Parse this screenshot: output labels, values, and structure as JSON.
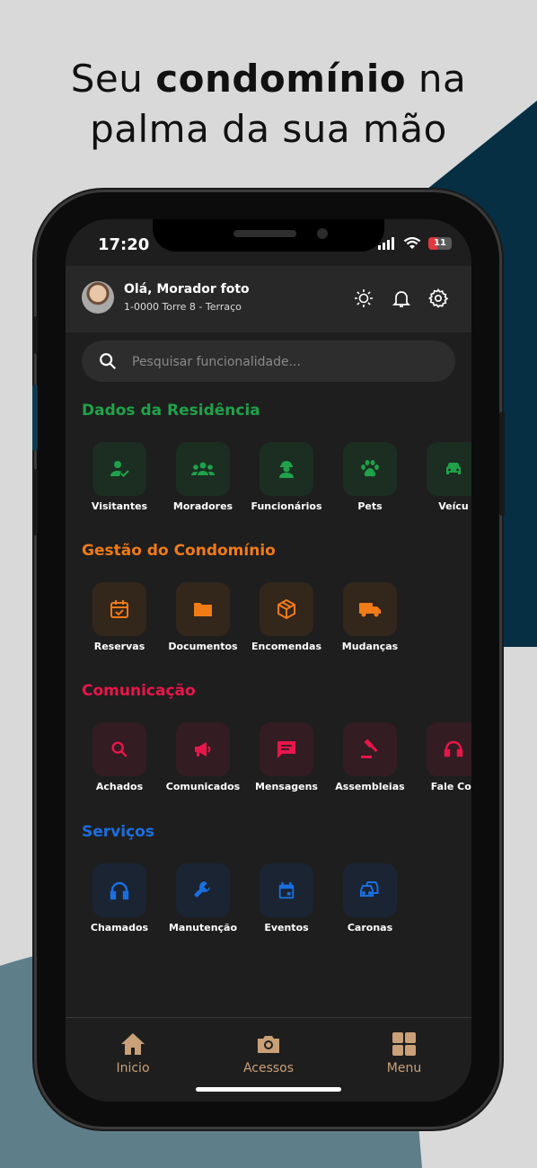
{
  "headline": {
    "part1": "Seu ",
    "bold": "condomínio",
    "part2": " na",
    "line2": "palma da sua mão"
  },
  "status_bar": {
    "time": "17:20",
    "battery": "11"
  },
  "header": {
    "greeting": "Olá, Morador foto",
    "address": "1-0000 Torre 8 - Terraço",
    "icons": [
      "sun-icon",
      "bell-icon",
      "gear-icon"
    ]
  },
  "search": {
    "placeholder": "Pesquisar funcionalidade..."
  },
  "colors": {
    "green": "#1fa24a",
    "orange": "#f07b17",
    "red": "#e8164a",
    "blue": "#1a6fe0",
    "nav": "#caa078"
  },
  "sections": [
    {
      "title": "Dados da Residência",
      "color": "green",
      "items": [
        {
          "label": "Visitantes",
          "icon": "person-check-icon"
        },
        {
          "label": "Moradores",
          "icon": "group-icon"
        },
        {
          "label": "Funcionários",
          "icon": "worker-icon"
        },
        {
          "label": "Pets",
          "icon": "paw-icon"
        },
        {
          "label": "Veícu",
          "icon": "car-icon"
        }
      ]
    },
    {
      "title": "Gestão do Condomínio",
      "color": "orange",
      "items": [
        {
          "label": "Reservas",
          "icon": "calendar-check-icon"
        },
        {
          "label": "Documentos",
          "icon": "folder-icon"
        },
        {
          "label": "Encomendas",
          "icon": "package-icon"
        },
        {
          "label": "Mudanças",
          "icon": "truck-icon"
        }
      ]
    },
    {
      "title": "Comunicação",
      "color": "red",
      "items": [
        {
          "label": "Achados",
          "icon": "search-icon"
        },
        {
          "label": "Comunicados",
          "icon": "megaphone-icon"
        },
        {
          "label": "Mensagens",
          "icon": "message-icon"
        },
        {
          "label": "Assembleias",
          "icon": "gavel-icon"
        },
        {
          "label": "Fale Cor",
          "icon": "headset-icon"
        }
      ]
    },
    {
      "title": "Serviços",
      "color": "blue",
      "items": [
        {
          "label": "Chamados",
          "icon": "headphones-icon"
        },
        {
          "label": "Manutenção",
          "icon": "wrench-icon"
        },
        {
          "label": "Eventos",
          "icon": "event-icon"
        },
        {
          "label": "Caronas",
          "icon": "cars-icon"
        }
      ]
    }
  ],
  "bottom_nav": [
    {
      "label": "Inicio",
      "icon": "home-icon"
    },
    {
      "label": "Acessos",
      "icon": "camera-icon"
    },
    {
      "label": "Menu",
      "icon": "grid-icon"
    }
  ]
}
